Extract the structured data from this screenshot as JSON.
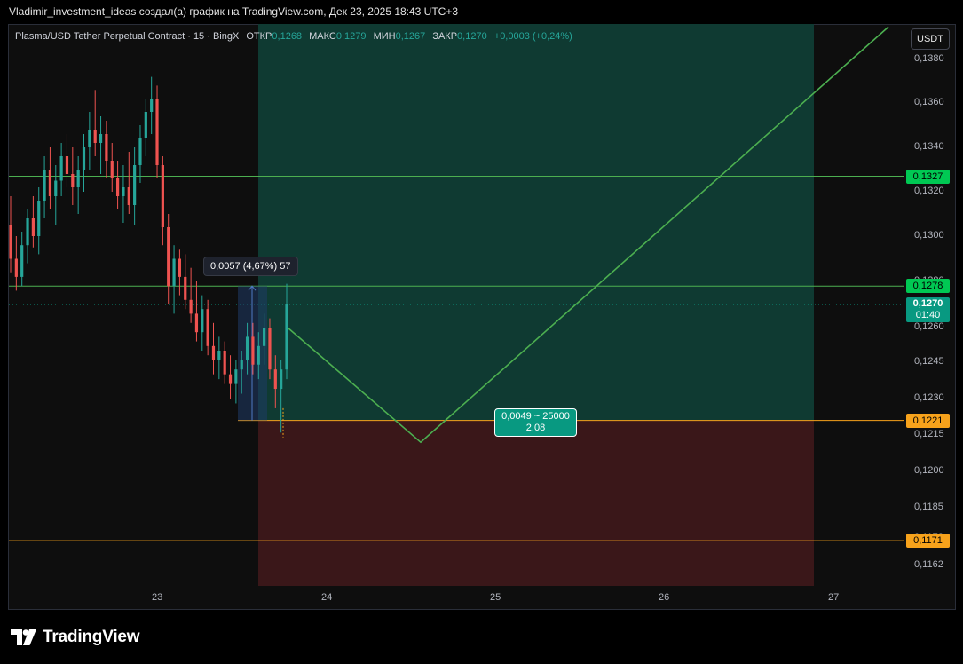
{
  "header": {
    "title": "Vladimir_investment_ideas создал(а) график на TradingView.com, Дек 23, 2025 18:43 UTC+3"
  },
  "legend": {
    "symbol": "Plasma/USD Tether Perpetual Contract · 15 · BingX",
    "open_label": "ОТКР",
    "open": "0,1268",
    "high_label": "МАКС",
    "high": "0,1279",
    "low_label": "МИН",
    "low": "0,1267",
    "close_label": "ЗАКР",
    "close": "0,1270",
    "change": "+0,0003 (+0,24%)"
  },
  "toolbar": {
    "currency": "USDT"
  },
  "price_axis": {
    "ticks": [
      "0,1380",
      "0,1360",
      "0,1340",
      "0,1320",
      "0,1300",
      "0,1280",
      "0,1260",
      "0,1245",
      "0,1230",
      "0,1215",
      "0,1200",
      "0,1185",
      "0,1172",
      "0,1162"
    ],
    "tick_values": [
      0.138,
      0.136,
      0.134,
      0.132,
      0.13,
      0.128,
      0.126,
      0.1245,
      0.123,
      0.1215,
      0.12,
      0.1185,
      0.1172,
      0.1162
    ]
  },
  "price_labels": {
    "target": "0,1327",
    "resistance": "0,1278",
    "current": "0,1270",
    "countdown": "01:40",
    "entry": "0,1221",
    "stop": "0,1171"
  },
  "time_axis": {
    "labels": [
      "23",
      "24",
      "25",
      "26",
      "27"
    ]
  },
  "measure_tool": {
    "text": "0,0057 (4,67%) 57"
  },
  "risk_reward": {
    "line1": "0,0049 ~ 25000",
    "line2": "2,08"
  },
  "brand": {
    "name": "TradingView"
  },
  "colors": {
    "up": "#26a69a",
    "down": "#ef5350",
    "level_green": "#4caf50",
    "level_orange": "#f7a21b",
    "profit_zone": "#0f3a32",
    "loss_zone": "#3a1719",
    "current_price": "#089981"
  },
  "chart_data": {
    "type": "candlestick",
    "symbol": "Plasma/USD Tether Perpetual Contract",
    "timeframe": "15",
    "exchange": "BingX",
    "x_labels": [
      "23",
      "24",
      "25",
      "26",
      "27"
    ],
    "ylim": [
      0.1152,
      0.1395
    ],
    "horizontal_levels": [
      {
        "name": "target",
        "value": 0.1327
      },
      {
        "name": "resistance",
        "value": 0.1278
      },
      {
        "name": "entry",
        "value": 0.1221
      },
      {
        "name": "stop",
        "value": 0.1171
      }
    ],
    "current_price": 0.127,
    "ohlc_summary": {
      "open": 0.1268,
      "high": 0.1279,
      "low": 0.1267,
      "close": 0.127
    },
    "candles": [
      {
        "o": 0.1305,
        "h": 0.1318,
        "l": 0.1284,
        "c": 0.129
      },
      {
        "o": 0.129,
        "h": 0.13,
        "l": 0.1276,
        "c": 0.1282
      },
      {
        "o": 0.1282,
        "h": 0.1302,
        "l": 0.1278,
        "c": 0.1296
      },
      {
        "o": 0.1296,
        "h": 0.1312,
        "l": 0.1288,
        "c": 0.1308
      },
      {
        "o": 0.1308,
        "h": 0.1318,
        "l": 0.1295,
        "c": 0.13
      },
      {
        "o": 0.13,
        "h": 0.1322,
        "l": 0.1292,
        "c": 0.1316
      },
      {
        "o": 0.1316,
        "h": 0.1336,
        "l": 0.1308,
        "c": 0.133
      },
      {
        "o": 0.133,
        "h": 0.134,
        "l": 0.1312,
        "c": 0.1318
      },
      {
        "o": 0.1318,
        "h": 0.1332,
        "l": 0.1305,
        "c": 0.1325
      },
      {
        "o": 0.1325,
        "h": 0.1342,
        "l": 0.1318,
        "c": 0.1336
      },
      {
        "o": 0.1336,
        "h": 0.1346,
        "l": 0.1322,
        "c": 0.1328
      },
      {
        "o": 0.1328,
        "h": 0.134,
        "l": 0.1314,
        "c": 0.1322
      },
      {
        "o": 0.1322,
        "h": 0.1336,
        "l": 0.131,
        "c": 0.133
      },
      {
        "o": 0.133,
        "h": 0.1346,
        "l": 0.132,
        "c": 0.134
      },
      {
        "o": 0.134,
        "h": 0.1356,
        "l": 0.133,
        "c": 0.1348
      },
      {
        "o": 0.1348,
        "h": 0.1366,
        "l": 0.1336,
        "c": 0.1342
      },
      {
        "o": 0.1342,
        "h": 0.1354,
        "l": 0.1328,
        "c": 0.1346
      },
      {
        "o": 0.1346,
        "h": 0.1352,
        "l": 0.1326,
        "c": 0.1334
      },
      {
        "o": 0.1334,
        "h": 0.1342,
        "l": 0.132,
        "c": 0.1326
      },
      {
        "o": 0.1326,
        "h": 0.1334,
        "l": 0.1312,
        "c": 0.1318
      },
      {
        "o": 0.1318,
        "h": 0.1332,
        "l": 0.1306,
        "c": 0.1322
      },
      {
        "o": 0.1322,
        "h": 0.1338,
        "l": 0.131,
        "c": 0.1314
      },
      {
        "o": 0.1314,
        "h": 0.134,
        "l": 0.1305,
        "c": 0.1332
      },
      {
        "o": 0.1332,
        "h": 0.135,
        "l": 0.1324,
        "c": 0.1344
      },
      {
        "o": 0.1344,
        "h": 0.1362,
        "l": 0.1336,
        "c": 0.1356
      },
      {
        "o": 0.1356,
        "h": 0.1372,
        "l": 0.1346,
        "c": 0.1362
      },
      {
        "o": 0.1362,
        "h": 0.1368,
        "l": 0.1326,
        "c": 0.1332
      },
      {
        "o": 0.1332,
        "h": 0.1336,
        "l": 0.1296,
        "c": 0.1304
      },
      {
        "o": 0.1304,
        "h": 0.131,
        "l": 0.127,
        "c": 0.1278
      },
      {
        "o": 0.1278,
        "h": 0.1296,
        "l": 0.1266,
        "c": 0.129
      },
      {
        "o": 0.129,
        "h": 0.1294,
        "l": 0.1274,
        "c": 0.1282
      },
      {
        "o": 0.1282,
        "h": 0.1292,
        "l": 0.1268,
        "c": 0.1272
      },
      {
        "o": 0.1272,
        "h": 0.1286,
        "l": 0.1262,
        "c": 0.1266
      },
      {
        "o": 0.1266,
        "h": 0.128,
        "l": 0.1254,
        "c": 0.1258
      },
      {
        "o": 0.1258,
        "h": 0.1274,
        "l": 0.125,
        "c": 0.1268
      },
      {
        "o": 0.1268,
        "h": 0.1272,
        "l": 0.1248,
        "c": 0.1252
      },
      {
        "o": 0.1252,
        "h": 0.1262,
        "l": 0.124,
        "c": 0.1246
      },
      {
        "o": 0.1246,
        "h": 0.1256,
        "l": 0.1238,
        "c": 0.125
      },
      {
        "o": 0.125,
        "h": 0.1254,
        "l": 0.1236,
        "c": 0.124
      },
      {
        "o": 0.124,
        "h": 0.1248,
        "l": 0.123,
        "c": 0.1236
      },
      {
        "o": 0.1236,
        "h": 0.1246,
        "l": 0.1228,
        "c": 0.1242
      },
      {
        "o": 0.1242,
        "h": 0.125,
        "l": 0.1232,
        "c": 0.1246
      },
      {
        "o": 0.1246,
        "h": 0.1262,
        "l": 0.124,
        "c": 0.1256
      },
      {
        "o": 0.1256,
        "h": 0.1262,
        "l": 0.124,
        "c": 0.1244
      },
      {
        "o": 0.1244,
        "h": 0.1258,
        "l": 0.1238,
        "c": 0.1252
      },
      {
        "o": 0.1252,
        "h": 0.1266,
        "l": 0.1244,
        "c": 0.126
      },
      {
        "o": 0.126,
        "h": 0.1264,
        "l": 0.1238,
        "c": 0.1242
      },
      {
        "o": 0.1242,
        "h": 0.1248,
        "l": 0.1226,
        "c": 0.1234
      },
      {
        "o": 0.1234,
        "h": 0.1246,
        "l": 0.1216,
        "c": 0.1242
      },
      {
        "o": 0.1242,
        "h": 0.1279,
        "l": 0.1238,
        "c": 0.127
      }
    ],
    "projection_path": [
      {
        "date": "Dec 23 ~20:00",
        "price": 0.126
      },
      {
        "date": "Dec 24 ~14:00",
        "price": 0.1212
      },
      {
        "date": "Dec 27 ~09:00",
        "price": 0.1395
      }
    ],
    "measure": {
      "change": "0,0057",
      "percent": "4,67%",
      "bars": 57
    },
    "position": {
      "entry": 0.1221,
      "target": 0.1278,
      "stop": 0.1171,
      "label": "0,0049 ~ 25000",
      "ratio": "2,08"
    }
  }
}
